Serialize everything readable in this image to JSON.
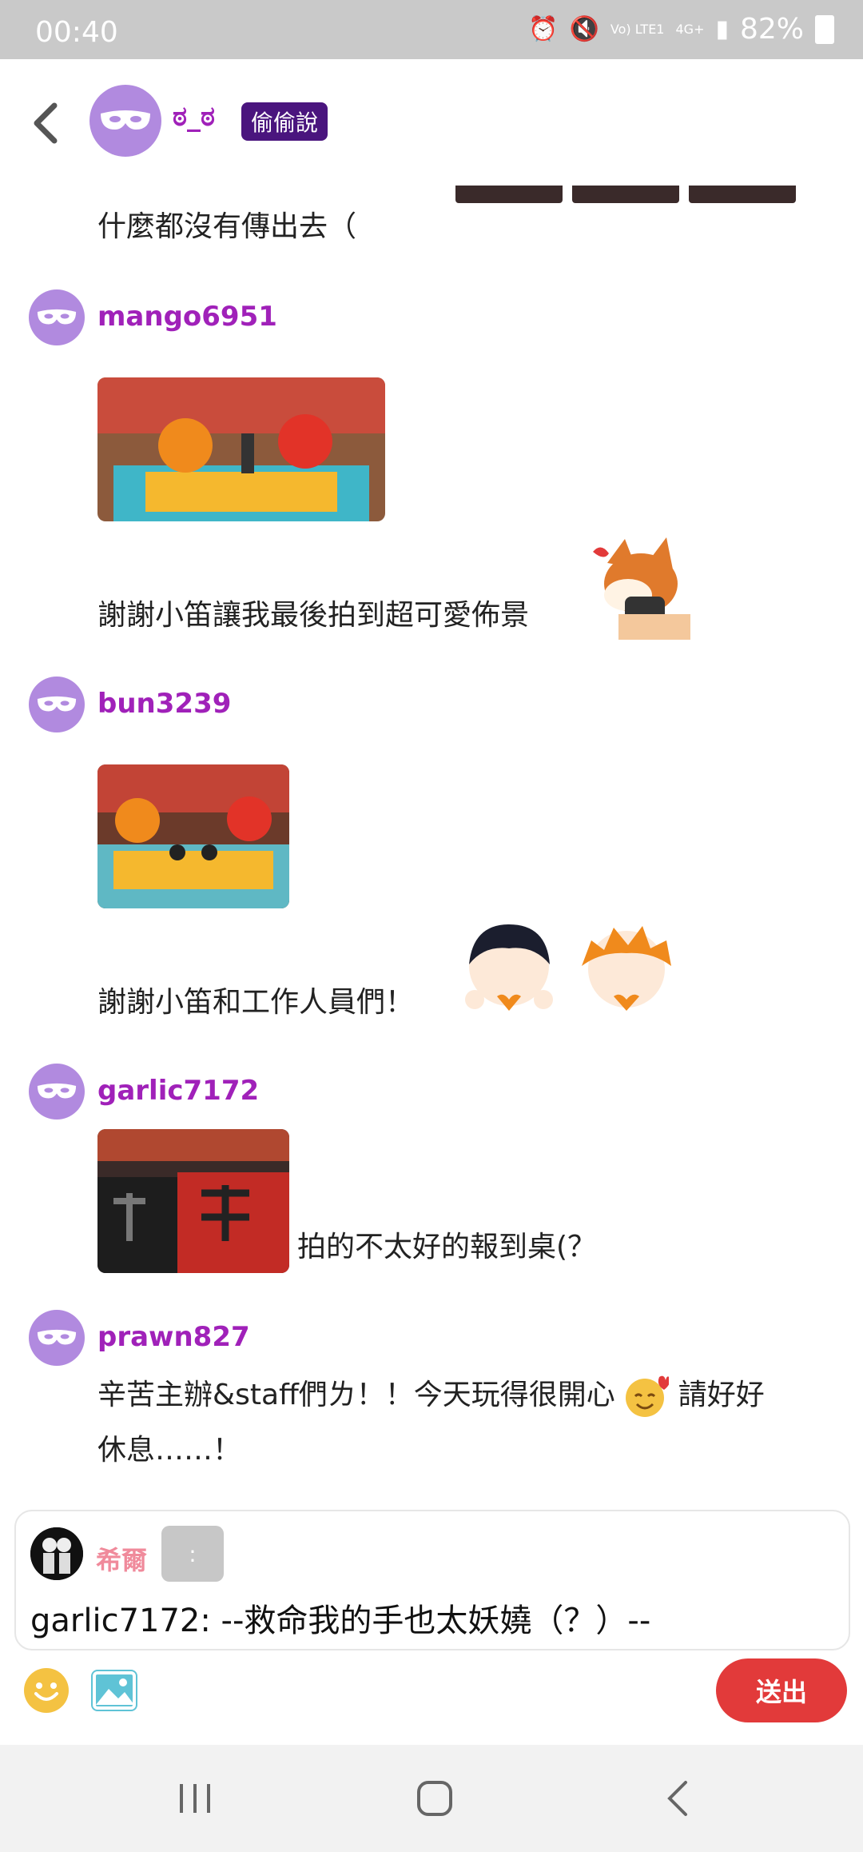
{
  "status_bar": {
    "time": "00:40",
    "network": "Vo) LTE1",
    "network_type": "4G+",
    "battery": "82%"
  },
  "header": {
    "board_name": "ಠ_ಠ",
    "tag": "偷偷說"
  },
  "messages": [
    {
      "text": "什麼都沒有傳出去（"
    },
    {
      "username": "mango6951",
      "text": "謝謝小笛讓我最後拍到超可愛佈景"
    },
    {
      "username": "bun3239",
      "text": "謝謝小笛和工作人員們！"
    },
    {
      "username": "garlic7172",
      "text": "拍的不太好的報到桌(？"
    },
    {
      "username": "prawn827",
      "text_line1": "辛苦主辦&staff們ㄌ！！今天玩得很開心",
      "text_line1b": "請好好",
      "text_line2": "休息……！"
    }
  ],
  "compose": {
    "reply_name": "希爾",
    "reply_chip": ":",
    "reply_text": "garlic7172: --救命我的手也太妖嬈（？）--",
    "send_label": "送出"
  },
  "icons": {
    "back": "back-arrow-icon",
    "emoji": "smiley-icon",
    "image": "image-icon"
  },
  "colors": {
    "username": "#a021b9",
    "tag_bg": "#4a157e",
    "send_bg": "#e23a3a",
    "avatar": "#b18adf"
  }
}
